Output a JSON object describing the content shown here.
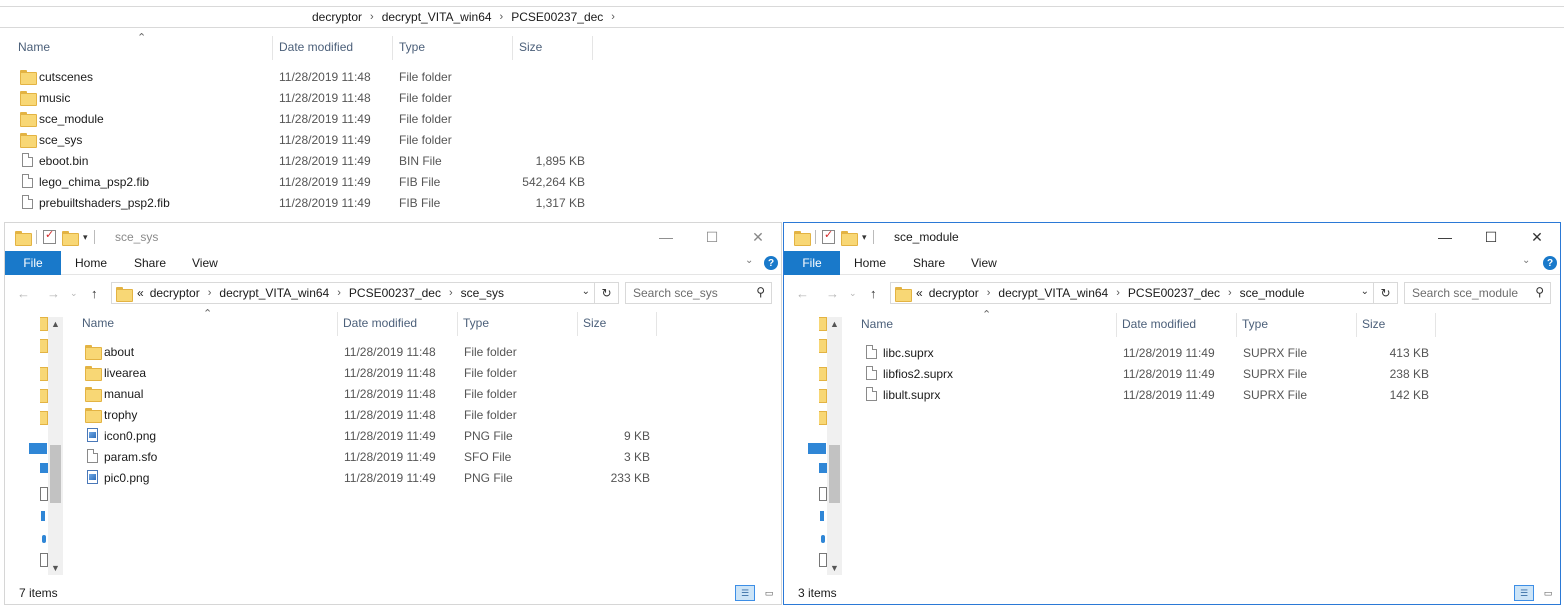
{
  "background_window": {
    "breadcrumb": [
      "decryptor",
      "decrypt_VITA_win64",
      "PCSE00237_dec"
    ],
    "columns": [
      "Name",
      "Date modified",
      "Type",
      "Size"
    ],
    "rows": [
      {
        "name": "cutscenes",
        "date": "11/28/2019 11:48",
        "type": "File folder",
        "size": "",
        "icon": "folder"
      },
      {
        "name": "music",
        "date": "11/28/2019 11:48",
        "type": "File folder",
        "size": "",
        "icon": "folder"
      },
      {
        "name": "sce_module",
        "date": "11/28/2019 11:49",
        "type": "File folder",
        "size": "",
        "icon": "folder"
      },
      {
        "name": "sce_sys",
        "date": "11/28/2019 11:49",
        "type": "File folder",
        "size": "",
        "icon": "folder"
      },
      {
        "name": "eboot.bin",
        "date": "11/28/2019 11:49",
        "type": "BIN File",
        "size": "1,895 KB",
        "icon": "file"
      },
      {
        "name": "lego_chima_psp2.fib",
        "date": "11/28/2019 11:49",
        "type": "FIB File",
        "size": "542,264 KB",
        "icon": "file"
      },
      {
        "name": "prebuiltshaders_psp2.fib",
        "date": "11/28/2019 11:49",
        "type": "FIB File",
        "size": "1,317 KB",
        "icon": "file"
      }
    ]
  },
  "left_window": {
    "title": "sce_sys",
    "ribbon": {
      "file": "File",
      "home": "Home",
      "share": "Share",
      "view": "View",
      "help": "?"
    },
    "address": {
      "prefix": "«",
      "crumbs": [
        "decryptor",
        "decrypt_VITA_win64",
        "PCSE00237_dec",
        "sce_sys"
      ]
    },
    "search_placeholder": "Search sce_sys",
    "columns": [
      "Name",
      "Date modified",
      "Type",
      "Size"
    ],
    "rows": [
      {
        "name": "about",
        "date": "11/28/2019 11:48",
        "type": "File folder",
        "size": "",
        "icon": "folder"
      },
      {
        "name": "livearea",
        "date": "11/28/2019 11:48",
        "type": "File folder",
        "size": "",
        "icon": "folder"
      },
      {
        "name": "manual",
        "date": "11/28/2019 11:48",
        "type": "File folder",
        "size": "",
        "icon": "folder"
      },
      {
        "name": "trophy",
        "date": "11/28/2019 11:48",
        "type": "File folder",
        "size": "",
        "icon": "folder"
      },
      {
        "name": "icon0.png",
        "date": "11/28/2019 11:49",
        "type": "PNG File",
        "size": "9 KB",
        "icon": "image"
      },
      {
        "name": "param.sfo",
        "date": "11/28/2019 11:49",
        "type": "SFO File",
        "size": "3 KB",
        "icon": "file"
      },
      {
        "name": "pic0.png",
        "date": "11/28/2019 11:49",
        "type": "PNG File",
        "size": "233 KB",
        "icon": "image"
      }
    ],
    "status": "7 items"
  },
  "right_window": {
    "title": "sce_module",
    "ribbon": {
      "file": "File",
      "home": "Home",
      "share": "Share",
      "view": "View",
      "help": "?"
    },
    "address": {
      "prefix": "«",
      "crumbs": [
        "decryptor",
        "decrypt_VITA_win64",
        "PCSE00237_dec",
        "sce_module"
      ]
    },
    "search_placeholder": "Search sce_module",
    "columns": [
      "Name",
      "Date modified",
      "Type",
      "Size"
    ],
    "rows": [
      {
        "name": "libc.suprx",
        "date": "11/28/2019 11:49",
        "type": "SUPRX File",
        "size": "413 KB",
        "icon": "file"
      },
      {
        "name": "libfios2.suprx",
        "date": "11/28/2019 11:49",
        "type": "SUPRX File",
        "size": "238 KB",
        "icon": "file"
      },
      {
        "name": "libult.suprx",
        "date": "11/28/2019 11:49",
        "type": "SUPRX File",
        "size": "142 KB",
        "icon": "file"
      }
    ],
    "status": "3 items"
  },
  "colors": {
    "accent": "#1979ca",
    "active_border": "#2b79d6",
    "folder": "#f8d775",
    "header_text": "#4c607a"
  }
}
